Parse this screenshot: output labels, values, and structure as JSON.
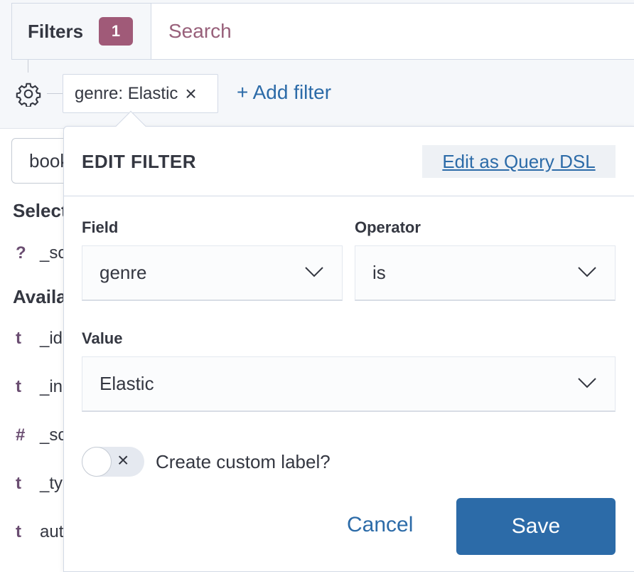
{
  "filter_bar": {
    "filters_label": "Filters",
    "filters_count": "1",
    "search_placeholder": "Search"
  },
  "filter_pill": {
    "text": "genre: Elastic",
    "remove_icon": "close-icon"
  },
  "add_filter_label": "+ Add filter",
  "sidebar": {
    "index_value": "books",
    "selected_heading": "Selected fields",
    "selected_fields": [
      {
        "type": "?",
        "name": "_source"
      }
    ],
    "available_heading": "Available fields",
    "available_fields": [
      {
        "type": "t",
        "name": "_id"
      },
      {
        "type": "t",
        "name": "_index"
      },
      {
        "type": "#",
        "name": "_score"
      },
      {
        "type": "t",
        "name": "_type"
      },
      {
        "type": "t",
        "name": "author"
      }
    ]
  },
  "popover": {
    "title": "EDIT FILTER",
    "query_dsl_link": "Edit as Query DSL",
    "field_label": "Field",
    "field_value": "genre",
    "operator_label": "Operator",
    "operator_value": "is",
    "value_label": "Value",
    "value_value": "Elastic",
    "custom_label_toggle": "Create custom label?",
    "cancel_label": "Cancel",
    "save_label": "Save"
  },
  "colors": {
    "accent": "#2c6ba8",
    "badge": "#a05a78",
    "field_type": "#6a4d71"
  }
}
